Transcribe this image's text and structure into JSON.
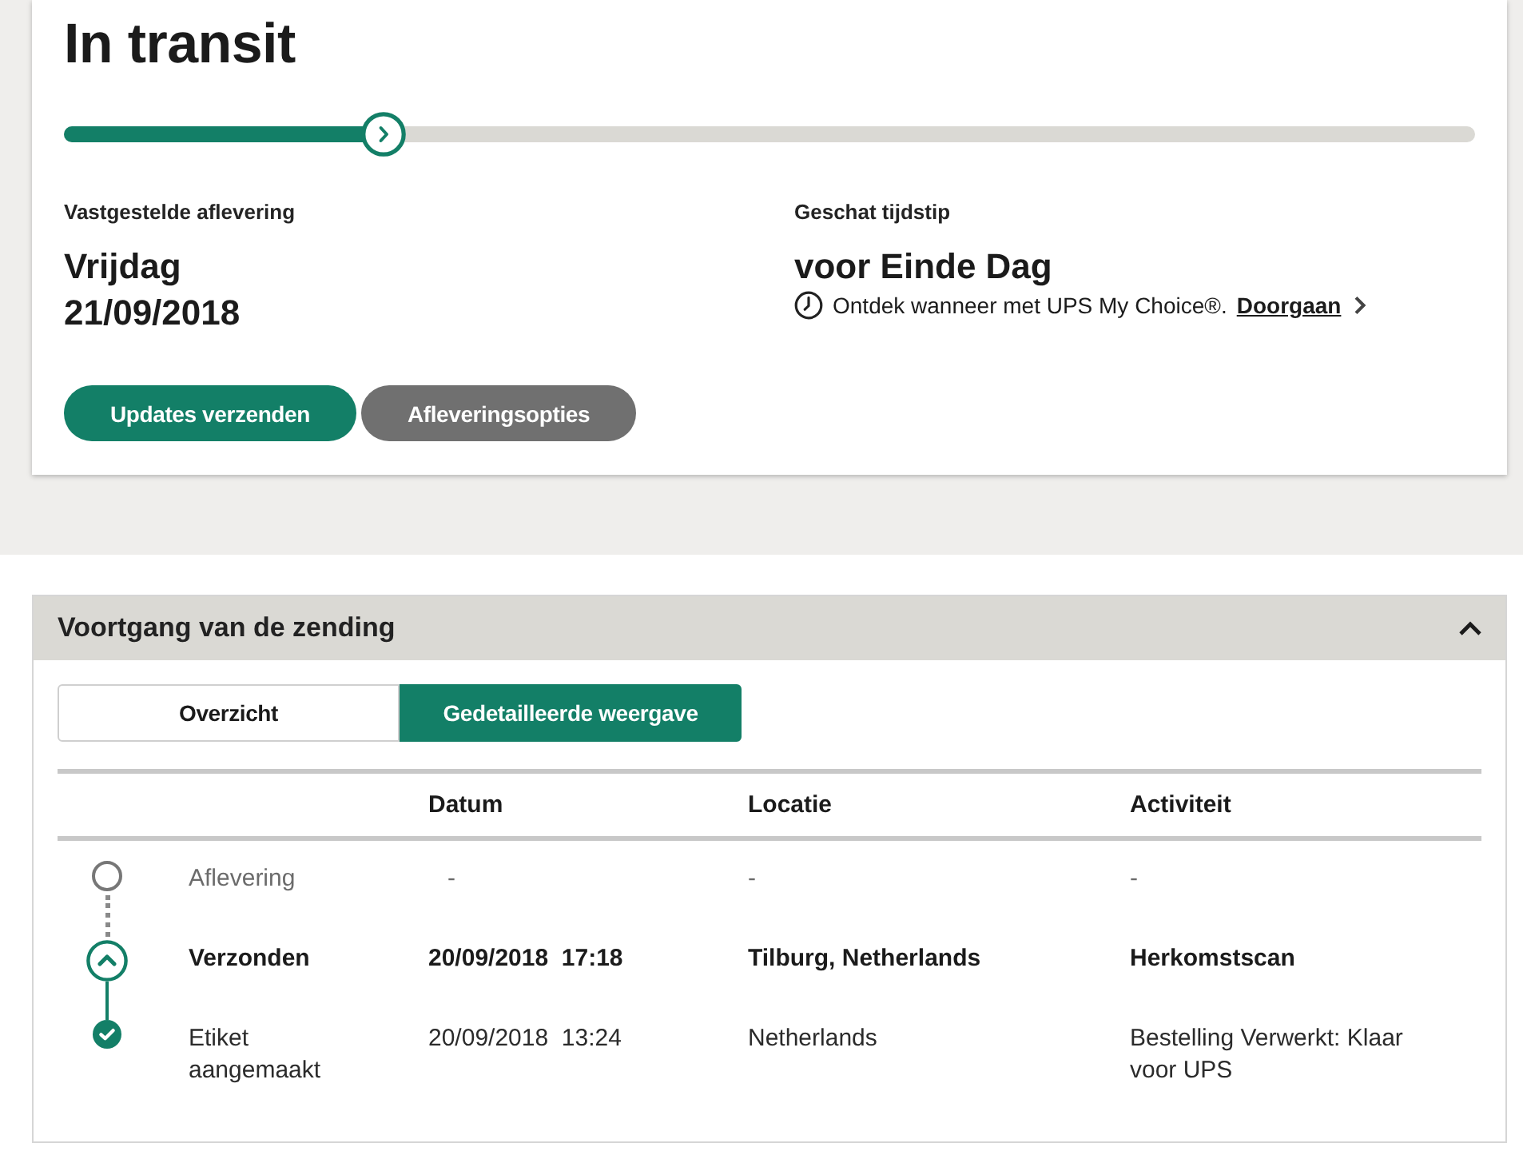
{
  "status": {
    "title": "In transit",
    "progress": {
      "level": 0.2265
    }
  },
  "delivery": {
    "label": "Vastgestelde aflevering",
    "day": "Vrijdag",
    "date": "21/09/2018"
  },
  "estimate": {
    "label": "Geschat tijdstip",
    "value": "voor Einde Dag",
    "note": "Ontdek wanneer met UPS My Choice®.",
    "link": "Doorgaan"
  },
  "buttons": [
    {
      "label": "Updates verzenden",
      "kind": "primary"
    },
    {
      "label": "Afleveringsopties",
      "kind": "secondary"
    }
  ],
  "progress_panel": {
    "title": "Voortgang van de zending",
    "expanded": true,
    "tabs": [
      {
        "label": "Overzicht",
        "selected": false
      },
      {
        "label": "Gedetailleerde weergave",
        "selected": true
      }
    ],
    "table": {
      "columns": [
        "Datum",
        "Locatie",
        "Activiteit"
      ],
      "rows": [
        {
          "kind": "pending",
          "status": "Aflevering",
          "date": "-",
          "location": "-",
          "activity": "-"
        },
        {
          "kind": "current",
          "status": "Verzonden",
          "date": "20/09/2018  17:18",
          "location": "Tilburg, Netherlands",
          "activity": "Herkomstscan"
        },
        {
          "kind": "done",
          "status": "Etiket aangemaakt",
          "date": "20/09/2018  13:24",
          "location": "Netherlands",
          "activity": "Bestelling Verwerkt: Klaar voor UPS"
        }
      ]
    }
  }
}
